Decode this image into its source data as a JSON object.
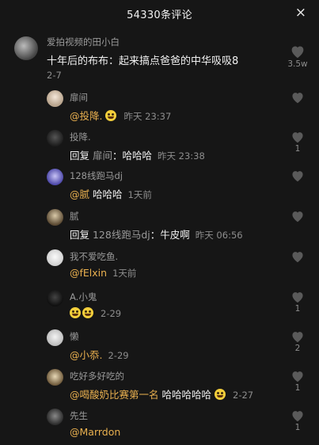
{
  "header": {
    "title": "54330条评论",
    "close_icon": "×"
  },
  "main_comment": {
    "user": "爱拍视频的田小白",
    "text": "十年后的布布：起来搞点爸爸的中华吸吸8",
    "date": "2-7",
    "likes": "3.5w"
  },
  "replies": [
    {
      "user": "扉间",
      "mention": "@投降.",
      "emoji_count": 1,
      "text": "",
      "reply_label": "",
      "reply_to": "",
      "time": "昨天 23:37",
      "likes": ""
    },
    {
      "user": "投降.",
      "mention": "",
      "emoji_count": 0,
      "text": "：哈哈哈",
      "reply_label": "回复 ",
      "reply_to": "扉间",
      "time": "昨天 23:38",
      "likes": "1"
    },
    {
      "user": "128线跑马dj",
      "mention": "@腻",
      "emoji_count": 0,
      "text": " 哈哈哈",
      "reply_label": "",
      "reply_to": "",
      "time": "1天前",
      "likes": ""
    },
    {
      "user": "腻",
      "mention": "",
      "emoji_count": 0,
      "text": "：牛皮啊",
      "reply_label": "回复 ",
      "reply_to": "128线跑马dj",
      "time": "昨天 06:56",
      "likes": ""
    },
    {
      "user": "我不爱吃鱼.",
      "mention": "@fElxin",
      "emoji_count": 0,
      "text": "",
      "reply_label": "",
      "reply_to": "",
      "time": "1天前",
      "likes": ""
    },
    {
      "user": "A.小鬼",
      "mention": "",
      "emoji_count": 2,
      "text": "",
      "reply_label": "",
      "reply_to": "",
      "time": "2-29",
      "likes": "1"
    },
    {
      "user": "懒",
      "mention": "@小忝.",
      "emoji_count": 0,
      "text": "",
      "reply_label": "",
      "reply_to": "",
      "time": "2-29",
      "likes": "2"
    },
    {
      "user": "吃好多好吃的",
      "mention": "@喝酸奶比赛第一名",
      "emoji_count": 0,
      "text": " 哈哈哈哈哈",
      "trail_emoji": 1,
      "reply_label": "",
      "reply_to": "",
      "time": "2-27",
      "likes": "1"
    },
    {
      "user": "先生",
      "mention": "@Marrdon",
      "emoji_count": 0,
      "text": "",
      "reply_label": "",
      "reply_to": "",
      "time": "",
      "likes": "1"
    }
  ],
  "colors": {
    "background": "#161616",
    "mention": "#e9b04f",
    "meta": "#8d8d8d"
  },
  "icons": {
    "like": "heart-icon",
    "close": "close-icon"
  }
}
